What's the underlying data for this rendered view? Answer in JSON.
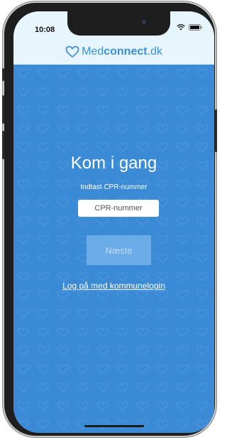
{
  "status_bar": {
    "time": "10:08"
  },
  "header": {
    "logo_part1": "Med",
    "logo_part2": "connect",
    "logo_part3": ".dk"
  },
  "main": {
    "title": "Kom i gang",
    "subtitle": "Indtast CPR-nummer",
    "cpr_placeholder": "CPR-nummer",
    "cpr_value": "",
    "next_label": "Næste",
    "login_link": "Log på med kommunelogin"
  },
  "colors": {
    "background": "#3a8ad6",
    "header_bg": "#e7f5fd",
    "brand": "#3b8ed8",
    "next_button": "#6fb0ea"
  },
  "icons": [
    "heart-logo-icon",
    "wifi-icon",
    "battery-icon",
    "heart-pattern"
  ]
}
